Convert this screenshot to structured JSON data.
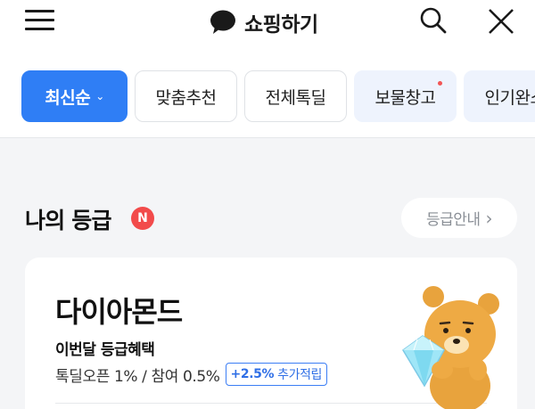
{
  "header": {
    "title": "쇼핑하기",
    "icons": [
      "menu-icon",
      "chat-icon",
      "search-icon",
      "close-icon"
    ]
  },
  "tabs": [
    {
      "label": "최신순",
      "active": true
    },
    {
      "label": "맞춤추천"
    },
    {
      "label": "전체톡딜"
    },
    {
      "label": "보물창고",
      "dot": true
    },
    {
      "label": "인기완소"
    }
  ],
  "grade_section": {
    "title": "나의 등급",
    "badge": "N",
    "guide_label": "등급안내"
  },
  "grade_card": {
    "grade_name": "다이아몬드",
    "benefit_title": "이번달 등급혜택",
    "benefit_text": "톡딜오픈 1% / 참여 0.5%",
    "bonus_rate": "+2.5%",
    "bonus_label": "추가적립"
  },
  "colors": {
    "accent": "#2f7ef5",
    "badge_red": "#f24b4b"
  }
}
